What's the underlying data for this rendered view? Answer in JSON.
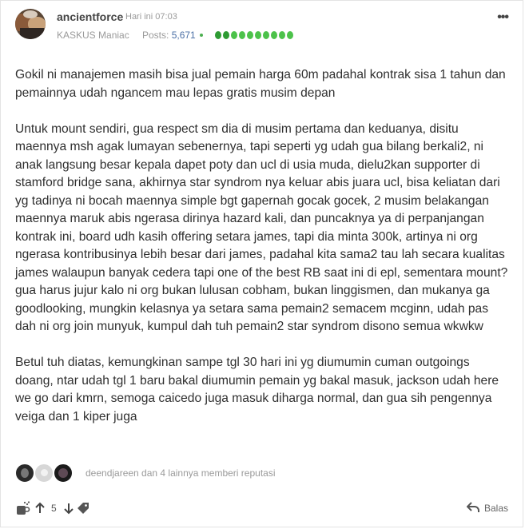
{
  "post": {
    "username": "ancientforce",
    "time": "Hari ini 07:03",
    "rank": "KASKUS Maniac",
    "posts_label": "Posts:",
    "posts_count": "5,671",
    "reputation_level": 1.0,
    "more_icon": "more-horizontal-icon"
  },
  "content": {
    "paragraphs": [
      "Gokil ni manajemen masih bisa jual pemain harga 60m padahal kontrak sisa 1 tahun dan pemainnya udah ngancem mau lepas gratis musim depan",
      "Untuk mount sendiri, gua respect sm dia di musim pertama dan keduanya, disitu maennya msh agak lumayan sebenernya, tapi seperti yg udah gua bilang berkali2, ni anak langsung besar kepala dapet poty dan ucl di usia muda, dielu2kan supporter di stamford bridge sana, akhirnya star syndrom nya keluar abis juara ucl, bisa keliatan dari yg tadinya ni bocah maennya simple bgt gapernah gocak gocek, 2 musim belakangan maennya maruk abis ngerasa dirinya hazard kali, dan puncaknya ya di perpanjangan kontrak ini, board udh kasih offering setara james, tapi dia minta 300k, artinya ni org ngerasa kontribusinya lebih besar dari james, padahal kita sama2 tau lah secara kualitas james walaupun banyak cedera tapi one of the best RB saat ini di epl, sementara mount? gua harus jujur kalo ni org bukan lulusan cobham, bukan linggismen, dan mukanya ga goodlooking, mungkin kelasnya ya setara sama pemain2 semacem mcginn, udah pas dah ni org join munyuk, kumpul dah tuh pemain2 star syndrom disono semua wkwkw",
      "Betul tuh diatas, kemungkinan sampe tgl 30 hari ini yg diumumin cuman outgoings doang, ntar udah tgl 1 baru bakal diumumin pemain yg bakal masuk, jackson udah here we go dari kmrn, semoga caicedo juga masuk diharga normal, dan gua sih pengennya veiga dan 1 kiper juga"
    ]
  },
  "reputation": {
    "text": "deendjareen dan 4 lainnya memberi reputasi"
  },
  "footer": {
    "vote_count": "5",
    "reply_label": "Balas"
  },
  "colors": {
    "reputation_dot": "#4cc24a",
    "link": "#4a6fa5",
    "muted": "#9a9a9a"
  }
}
